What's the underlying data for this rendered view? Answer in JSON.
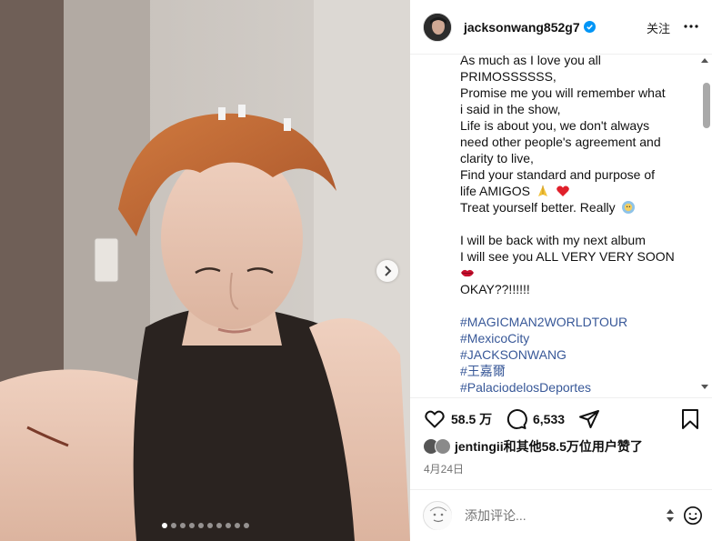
{
  "post": {
    "username": "jacksonwang852g7",
    "follow_label": "关注",
    "caption_lines": [
      "As much as I love you all",
      "PRIMOSSSSSS,",
      "Promise me you will remember what",
      "i said in the show,",
      "Life is about you, we don't always",
      "need other people's agreement and",
      "clarity to live,",
      "Find your standard and purpose of",
      "life AMIGOS",
      "Treat yourself better. Really",
      "",
      "I will be back with my next album",
      "I will see you ALL VERY VERY SOON",
      "",
      "OKAY??!!!!!!"
    ],
    "hashtags": [
      "#MAGICMAN2WORLDTOUR",
      "#MexicoCity",
      "#JACKSONWANG",
      "#王嘉爾",
      "#PalaciodelosDeportes"
    ],
    "likes_count": "58.5 万",
    "comments_count": "6,533",
    "liked_by_text": "jentingii和其他58.5万位用户赞了",
    "date": "4月24日",
    "comment_placeholder": "添加评论...",
    "carousel": {
      "total_slides": 10,
      "active_index": 0
    }
  },
  "icons": {
    "verified": "verified-badge-icon",
    "more": "more-options-icon",
    "like": "heart-icon",
    "comment": "comment-icon",
    "share": "share-icon",
    "save": "bookmark-icon",
    "next": "chevron-right-icon",
    "emoji": "smile-icon"
  },
  "colors": {
    "verified": "#0095f6",
    "hashtag": "#385898",
    "muted": "#737373"
  }
}
